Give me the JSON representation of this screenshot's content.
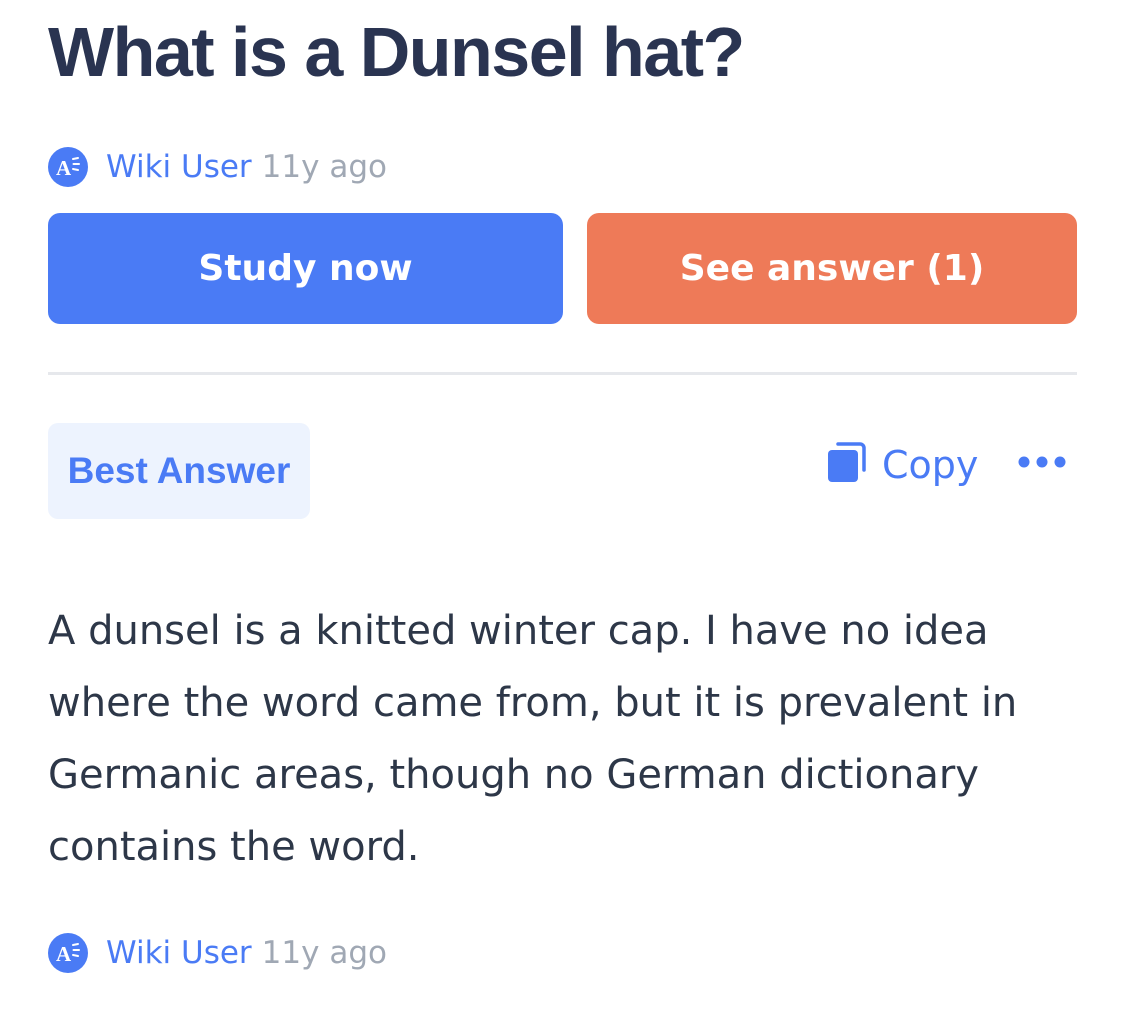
{
  "question": {
    "title": "What is a Dunsel hat?",
    "author": "Wiki User",
    "age": "11y ago"
  },
  "actions": {
    "study_now_label": "Study now",
    "see_answer_label": "See answer (1)"
  },
  "answer": {
    "badge": "Best Answer",
    "copy_label": "Copy",
    "more_icon": "ellipsis-icon",
    "body": "A dunsel is a knitted winter cap. I have no idea where the word came from, but it is prevalent in Germanic areas, though no German dictionary contains the word.",
    "author": "Wiki User",
    "age": "11y ago"
  },
  "colors": {
    "primary": "#4a7bf5",
    "accent": "#ee7a58",
    "title": "#2a3451",
    "muted": "#a0a8b4",
    "badge_bg": "#edf3fe"
  }
}
